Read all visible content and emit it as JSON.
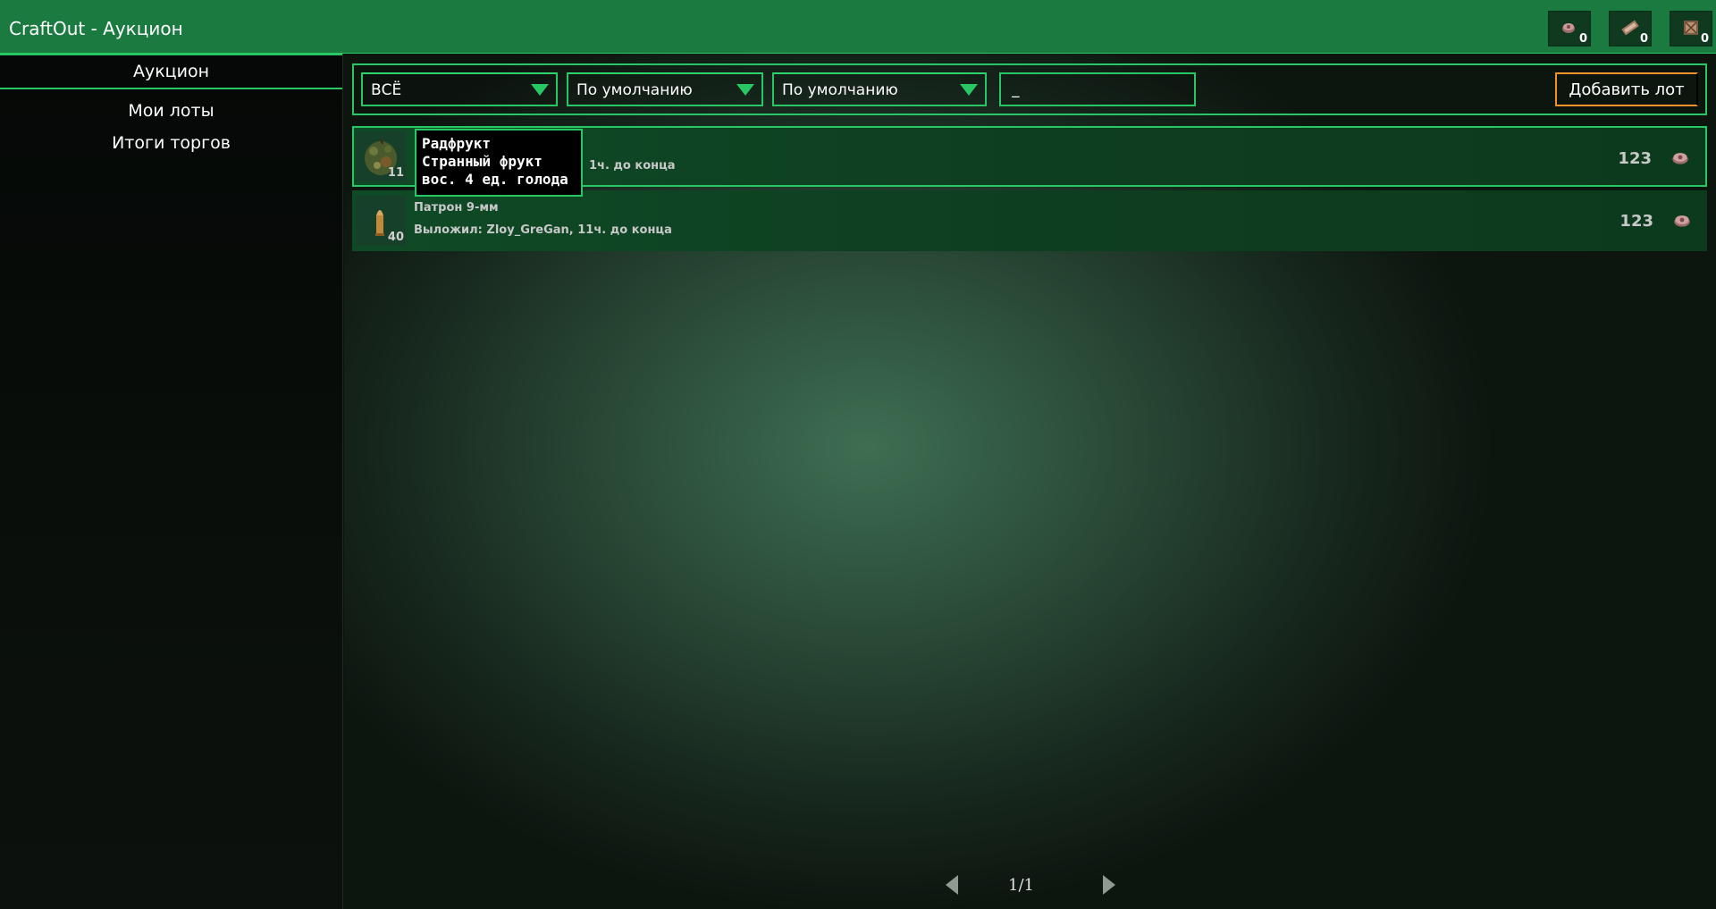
{
  "window": {
    "title": "CraftOut - Аукцион"
  },
  "currencies": [
    {
      "icon": "caps-icon",
      "count": "0"
    },
    {
      "icon": "ticket-icon",
      "count": "0"
    },
    {
      "icon": "crate-icon",
      "count": "0"
    }
  ],
  "sidebar": {
    "items": [
      {
        "label": "Аукцион",
        "active": true
      },
      {
        "label": "Мои лоты",
        "active": false
      },
      {
        "label": "Итоги торгов",
        "active": false
      }
    ]
  },
  "toolbar": {
    "category": "ВСЁ",
    "sort1": "По умолчанию",
    "sort2": "По умолчанию",
    "search_value": "_",
    "add_button": "Добавить лот"
  },
  "lots": [
    {
      "icon": "radfruit-icon",
      "count": "11",
      "meta_tail": "1ч. до конца",
      "price": "123",
      "currency_icon": "caps-icon"
    },
    {
      "icon": "bullet-icon",
      "count": "40",
      "name": "Патрон 9-мм",
      "meta": "Выложил: Zloy_GreGan, 11ч. до конца",
      "price": "123",
      "currency_icon": "caps-icon"
    }
  ],
  "tooltip": {
    "line1": "Радфрукт",
    "line2": "Странный фрукт",
    "line3": "вос. 4 ед. голода"
  },
  "pagination": {
    "label": "1/1"
  },
  "colors": {
    "accent": "#27c763",
    "titlebar": "#1a7a40",
    "add_button_border": "#f0902b"
  }
}
